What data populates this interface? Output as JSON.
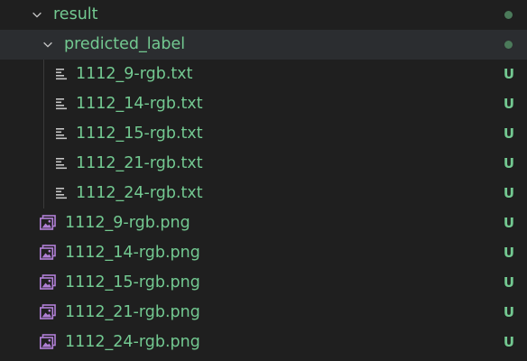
{
  "colors": {
    "background": "#1f1f1f",
    "selected_row": "#2b2d30",
    "untracked_text": "#73c991",
    "folder_dot": "#4b7a5a",
    "image_icon": "#b180d7",
    "text_icon": "#c5c5c5",
    "chevron": "#c5c5c5"
  },
  "tree": {
    "result_folder": {
      "label": "result",
      "icon": "chevron-down-icon",
      "status": "dot"
    },
    "predicted_folder": {
      "label": "predicted_label",
      "icon": "chevron-down-icon",
      "status": "dot"
    },
    "txt_files": [
      {
        "label": "1112_9-rgb.txt",
        "badge": "U",
        "icon": "text-file-icon"
      },
      {
        "label": "1112_14-rgb.txt",
        "badge": "U",
        "icon": "text-file-icon"
      },
      {
        "label": "1112_15-rgb.txt",
        "badge": "U",
        "icon": "text-file-icon"
      },
      {
        "label": "1112_21-rgb.txt",
        "badge": "U",
        "icon": "text-file-icon"
      },
      {
        "label": "1112_24-rgb.txt",
        "badge": "U",
        "icon": "text-file-icon"
      }
    ],
    "png_files": [
      {
        "label": "1112_9-rgb.png",
        "badge": "U",
        "icon": "image-file-icon"
      },
      {
        "label": "1112_14-rgb.png",
        "badge": "U",
        "icon": "image-file-icon"
      },
      {
        "label": "1112_15-rgb.png",
        "badge": "U",
        "icon": "image-file-icon"
      },
      {
        "label": "1112_21-rgb.png",
        "badge": "U",
        "icon": "image-file-icon"
      },
      {
        "label": "1112_24-rgb.png",
        "badge": "U",
        "icon": "image-file-icon"
      }
    ]
  }
}
